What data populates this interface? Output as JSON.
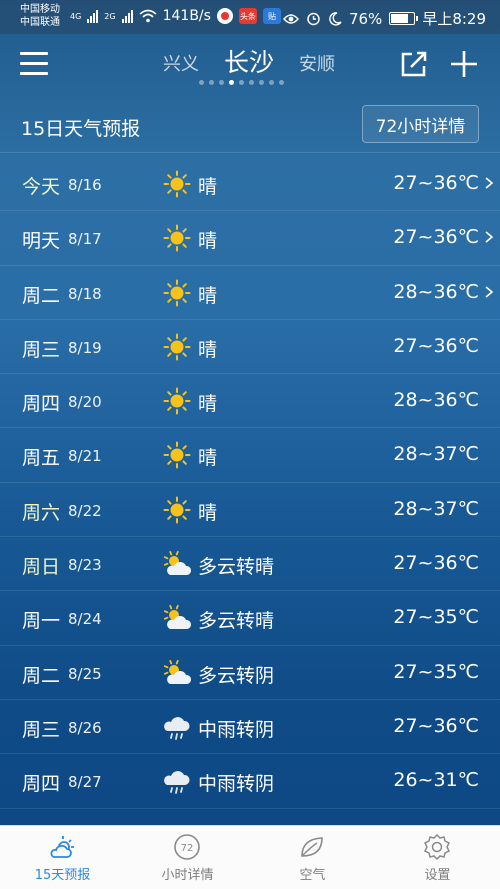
{
  "status": {
    "carrier1": "中国移动",
    "carrier2": "中国联通",
    "net1": "4G",
    "net2": "2G",
    "speed": "141B/s",
    "badge1": "头条",
    "badge2": "贴",
    "battery": "76%",
    "time": "早上8:29",
    "icons": [
      "signal-icon",
      "wifi-icon",
      "eye-icon",
      "alarm-icon",
      "moon-icon",
      "battery-icon"
    ]
  },
  "header": {
    "city_prev": "兴义",
    "city_current": "长沙",
    "city_next": "安顺",
    "page_count": 9,
    "page_active": 3
  },
  "section": {
    "title": "15日天气预报",
    "detail_button": "72小时详情"
  },
  "forecast": [
    {
      "day": "今天",
      "date": "8/16",
      "icon": "sunny-icon",
      "cond": "晴",
      "temp": "27~36℃",
      "arrow": true,
      "weekend": true
    },
    {
      "day": "明天",
      "date": "8/17",
      "icon": "sunny-icon",
      "cond": "晴",
      "temp": "27~36℃",
      "arrow": true,
      "weekend": false
    },
    {
      "day": "周二",
      "date": "8/18",
      "icon": "sunny-icon",
      "cond": "晴",
      "temp": "28~36℃",
      "arrow": true,
      "weekend": false
    },
    {
      "day": "周三",
      "date": "8/19",
      "icon": "sunny-icon",
      "cond": "晴",
      "temp": "27~36℃",
      "arrow": false,
      "weekend": false
    },
    {
      "day": "周四",
      "date": "8/20",
      "icon": "sunny-icon",
      "cond": "晴",
      "temp": "28~36℃",
      "arrow": false,
      "weekend": false
    },
    {
      "day": "周五",
      "date": "8/21",
      "icon": "sunny-icon",
      "cond": "晴",
      "temp": "28~37℃",
      "arrow": false,
      "weekend": false
    },
    {
      "day": "周六",
      "date": "8/22",
      "icon": "sunny-icon",
      "cond": "晴",
      "temp": "28~37℃",
      "arrow": false,
      "weekend": true
    },
    {
      "day": "周日",
      "date": "8/23",
      "icon": "partly-cloudy-icon",
      "cond": "多云转晴",
      "temp": "27~36℃",
      "arrow": false,
      "weekend": true
    },
    {
      "day": "周一",
      "date": "8/24",
      "icon": "partly-cloudy-icon",
      "cond": "多云转晴",
      "temp": "27~35℃",
      "arrow": false,
      "weekend": false
    },
    {
      "day": "周二",
      "date": "8/25",
      "icon": "partly-cloudy-icon",
      "cond": "多云转阴",
      "temp": "27~35℃",
      "arrow": false,
      "weekend": false
    },
    {
      "day": "周三",
      "date": "8/26",
      "icon": "rain-icon",
      "cond": "中雨转阴",
      "temp": "27~36℃",
      "arrow": false,
      "weekend": false
    },
    {
      "day": "周四",
      "date": "8/27",
      "icon": "rain-icon",
      "cond": "中雨转阴",
      "temp": "26~31℃",
      "arrow": false,
      "weekend": false
    }
  ],
  "tabs": [
    {
      "label": "15天预报",
      "icon": "weather-forecast-icon",
      "active": true
    },
    {
      "label": "小时详情",
      "icon": "hourly-clock-icon",
      "active": false
    },
    {
      "label": "空气",
      "icon": "leaf-icon",
      "active": false
    },
    {
      "label": "设置",
      "icon": "gear-icon",
      "active": false
    }
  ],
  "colors": {
    "sun": "#f7c21a",
    "active_tab": "#2a8be0",
    "inactive_tab": "#7d7d7d",
    "weekend_text": "#f0f5c8"
  }
}
